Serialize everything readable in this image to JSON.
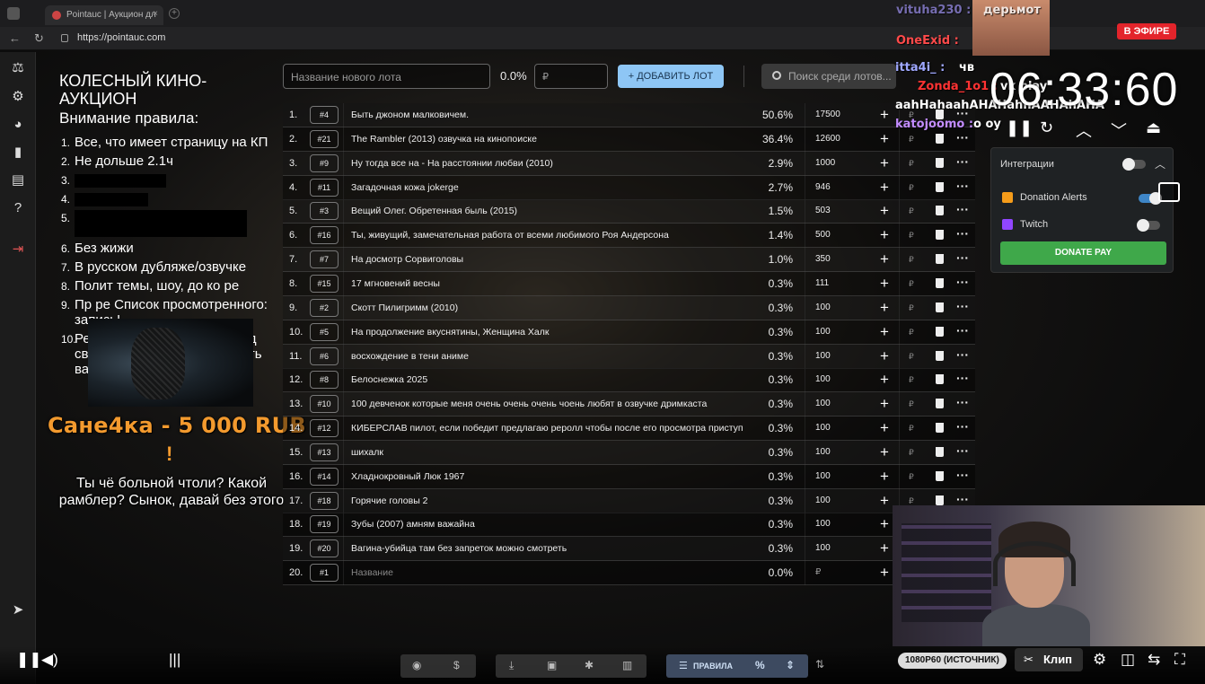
{
  "browser": {
    "tab_title": "Pointauc | Аукцион дл",
    "url": "https://pointauc.com"
  },
  "rules": {
    "title": "КОЛЕСНЫЙ КИНО-АУКЦИОН",
    "subtitle": "Внимание правила:",
    "items": [
      {
        "n": "1.",
        "text": "Все, что имеет страницу на КП"
      },
      {
        "n": "2.",
        "text": "Не дольше 2.1ч"
      },
      {
        "n": "3.",
        "text": ""
      },
      {
        "n": "4.",
        "text": ""
      },
      {
        "n": "5.",
        "text": ""
      },
      {
        "n": "6.",
        "text": "Без жижи"
      },
      {
        "n": "7.",
        "text": "В русском дубляже/озвучке"
      },
      {
        "n": "8.",
        "text": "Полит темы, шоу, до ко ре"
      },
      {
        "n": "9.",
        "text": "Пр ре Список просмотренного: запись!"
      },
      {
        "n": "10.",
        "text": "Рекомендуется донатить под своим ником, чтобы заменить вариант в случае чего."
      }
    ]
  },
  "donation": {
    "text": "Сане4ка - 5 000 RUB",
    "excl": "!",
    "message": "Ты чё больной чтоли? Какой рамблер? Сынок, давай без этого"
  },
  "controls": {
    "lot_placeholder": "Название нового лота",
    "percent": "0.0%",
    "rub_placeholder": "₽",
    "add_button": "+ ДОБАВИТЬ ЛОТ",
    "search_placeholder": "Поиск среди лотов..."
  },
  "lots": [
    {
      "idx": "1.",
      "id": "#4",
      "name": "Быть джоном малковичем.",
      "pct": "50.6%",
      "amount": "17500"
    },
    {
      "idx": "2.",
      "id": "#21",
      "name": "The Rambler (2013) озвучка на кинопоиске",
      "pct": "36.4%",
      "amount": "12600"
    },
    {
      "idx": "3.",
      "id": "#9",
      "name": "Ну тогда все на - На расстоянии любви (2010)",
      "pct": "2.9%",
      "amount": "1000"
    },
    {
      "idx": "4.",
      "id": "#11",
      "name": "Загадочная кожа jokerge",
      "pct": "2.7%",
      "amount": "946"
    },
    {
      "idx": "5.",
      "id": "#3",
      "name": "Вещий Олег. Обретенная быль (2015)",
      "pct": "1.5%",
      "amount": "503"
    },
    {
      "idx": "6.",
      "id": "#16",
      "name": "Ты, живущий, замечательная работа от всеми любимого Роя Андерсона",
      "pct": "1.4%",
      "amount": "500"
    },
    {
      "idx": "7.",
      "id": "#7",
      "name": "На досмотр Сорвиголовы",
      "pct": "1.0%",
      "amount": "350"
    },
    {
      "idx": "8.",
      "id": "#15",
      "name": "17 мгновений весны",
      "pct": "0.3%",
      "amount": "111"
    },
    {
      "idx": "9.",
      "id": "#2",
      "name": "Скотт Пилигримм (2010)",
      "pct": "0.3%",
      "amount": "100"
    },
    {
      "idx": "10.",
      "id": "#5",
      "name": "На продолжение вкуснятины, Женщина Халк",
      "pct": "0.3%",
      "amount": "100"
    },
    {
      "idx": "11.",
      "id": "#6",
      "name": "восхождение в тени аниме",
      "pct": "0.3%",
      "amount": "100"
    },
    {
      "idx": "12.",
      "id": "#8",
      "name": "Белоснежка 2025",
      "pct": "0.3%",
      "amount": "100"
    },
    {
      "idx": "13.",
      "id": "#10",
      "name": "100 девченок которые меня очень очень очень чоень любят в озвучке дримкаста",
      "pct": "0.3%",
      "amount": "100"
    },
    {
      "idx": "14.",
      "id": "#12",
      "name": "КИБЕРСЛАВ пилот, если победит предлагаю реролл чтобы после его просмотра приступить к ч",
      "pct": "0.3%",
      "amount": "100"
    },
    {
      "idx": "15.",
      "id": "#13",
      "name": "шихалк",
      "pct": "0.3%",
      "amount": "100"
    },
    {
      "idx": "16.",
      "id": "#14",
      "name": "Хладнокровный Люк 1967",
      "pct": "0.3%",
      "amount": "100"
    },
    {
      "idx": "17.",
      "id": "#18",
      "name": "Горячие головы 2",
      "pct": "0.3%",
      "amount": "100"
    },
    {
      "idx": "18.",
      "id": "#19",
      "name": "Зубы (2007) амням важайна",
      "pct": "0.3%",
      "amount": "100"
    },
    {
      "idx": "19.",
      "id": "#20",
      "name": "Вагина-убийца там без запреток можно смотреть",
      "pct": "0.3%",
      "amount": "100"
    },
    {
      "idx": "20.",
      "id": "#1",
      "name": "Название",
      "pct": "0.0%",
      "amount": "₽"
    }
  ],
  "stream": {
    "timer": "06:33:60",
    "live_badge": "В ЭФИРЕ",
    "chat": [
      {
        "user": "vituha230 :",
        "msg": "дерьмот"
      },
      {
        "user": "OneExid :",
        "msg": ""
      },
      {
        "user": "itta4i_ :",
        "msg": "чв"
      },
      {
        "user": "Zonda_1o1 :",
        "msg": "vk play"
      },
      {
        "user": "",
        "msg": "aahHahaahAHAHahhAAHAhAHA"
      },
      {
        "user": "katojoomo :",
        "msg": "o oy"
      }
    ],
    "integrations": {
      "title": "Интеграции",
      "donation_alerts": "Donation Alerts",
      "twitch": "Twitch",
      "donate_pay": "DONATE PAY"
    },
    "quality": "1080P60 (ИСТОЧНИК)",
    "clip": "Клип"
  },
  "toolbar": {
    "rules_label": "ПРАВИЛА"
  },
  "colors": {
    "accent_blue": "#8ec6f5",
    "donation_orange": "#f39a2e",
    "live_red": "#e3242b",
    "donate_green": "#3fa84a"
  }
}
